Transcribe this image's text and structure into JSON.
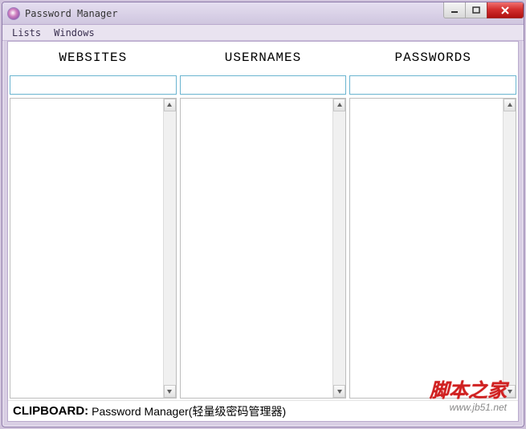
{
  "window": {
    "title": "Password Manager"
  },
  "menubar": {
    "items": [
      "Lists",
      "Windows"
    ]
  },
  "columns": {
    "headers": [
      "WEBSITES",
      "USERNAMES",
      "PASSWORDS"
    ],
    "inputs": {
      "websites": "",
      "usernames": "",
      "passwords": ""
    }
  },
  "lists": {
    "websites": [],
    "usernames": [],
    "passwords": []
  },
  "statusbar": {
    "label": "CLIPBOARD:",
    "value": "Password Manager(轻量级密码管理器)"
  },
  "watermark": {
    "text_cn": "脚本之家",
    "url": "www.jb51.net"
  }
}
